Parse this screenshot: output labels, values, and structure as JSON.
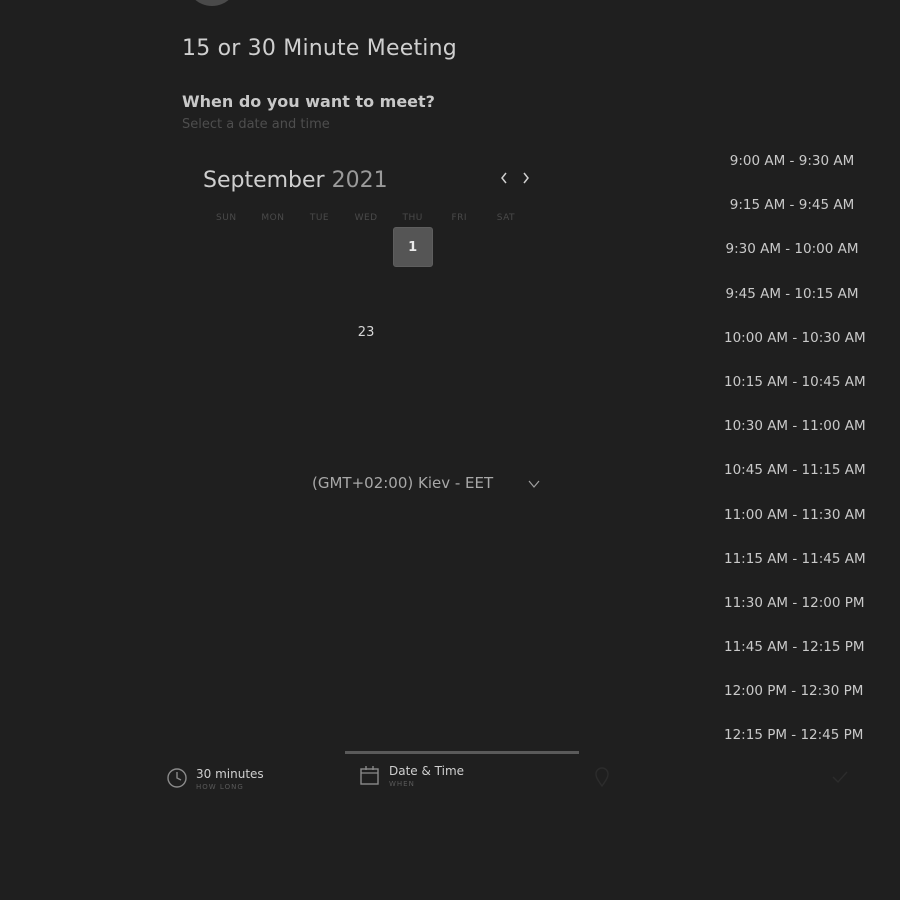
{
  "event": {
    "title": "15 or 30 Minute Meeting",
    "question": "When do you want to meet?",
    "subtitle": "Select a date and time"
  },
  "calendar": {
    "month": "September",
    "year": "2021",
    "prev_icon": "chevron-left-icon",
    "next_icon": "chevron-right-icon",
    "weekdays": [
      "SUN",
      "MON",
      "TUE",
      "WED",
      "THU",
      "FRI",
      "SAT"
    ],
    "days": [
      "",
      "",
      "",
      "",
      "1",
      "",
      "",
      "",
      "",
      "",
      "",
      "",
      "",
      "",
      "",
      "",
      "",
      "23",
      "",
      "",
      "",
      "",
      "",
      "",
      "",
      "",
      "",
      "",
      "",
      "",
      "",
      "",
      "",
      "",
      ""
    ],
    "selected_day": "1",
    "available_days": [
      "1",
      "23"
    ]
  },
  "timezone": {
    "label": "(GMT+02:00) Kiev - EET"
  },
  "slots": [
    "9:00 AM - 9:30 AM",
    "9:15 AM - 9:45 AM",
    "9:30 AM - 10:00 AM",
    "9:45 AM - 10:15 AM",
    "10:00 AM - 10:30 AM",
    "10:15 AM - 10:45 AM",
    "10:30 AM - 11:00 AM",
    "10:45 AM - 11:15 AM",
    "11:00 AM - 11:30 AM",
    "11:15 AM - 11:45 AM",
    "11:30 AM - 12:00 PM",
    "11:45 AM - 12:15 PM",
    "12:00 PM - 12:30 PM",
    "12:15 PM - 12:45 PM"
  ],
  "steps": {
    "duration": {
      "label": "30 minutes",
      "sub": "HOW LONG",
      "icon": "clock-icon"
    },
    "datetime": {
      "label": "Date & Time",
      "sub": "WHEN",
      "icon": "calendar-icon"
    }
  },
  "colors": {
    "background": "#1f1f1f",
    "selected_day_bg": "#555555",
    "active_tab_underline": "#5a5a5a"
  }
}
